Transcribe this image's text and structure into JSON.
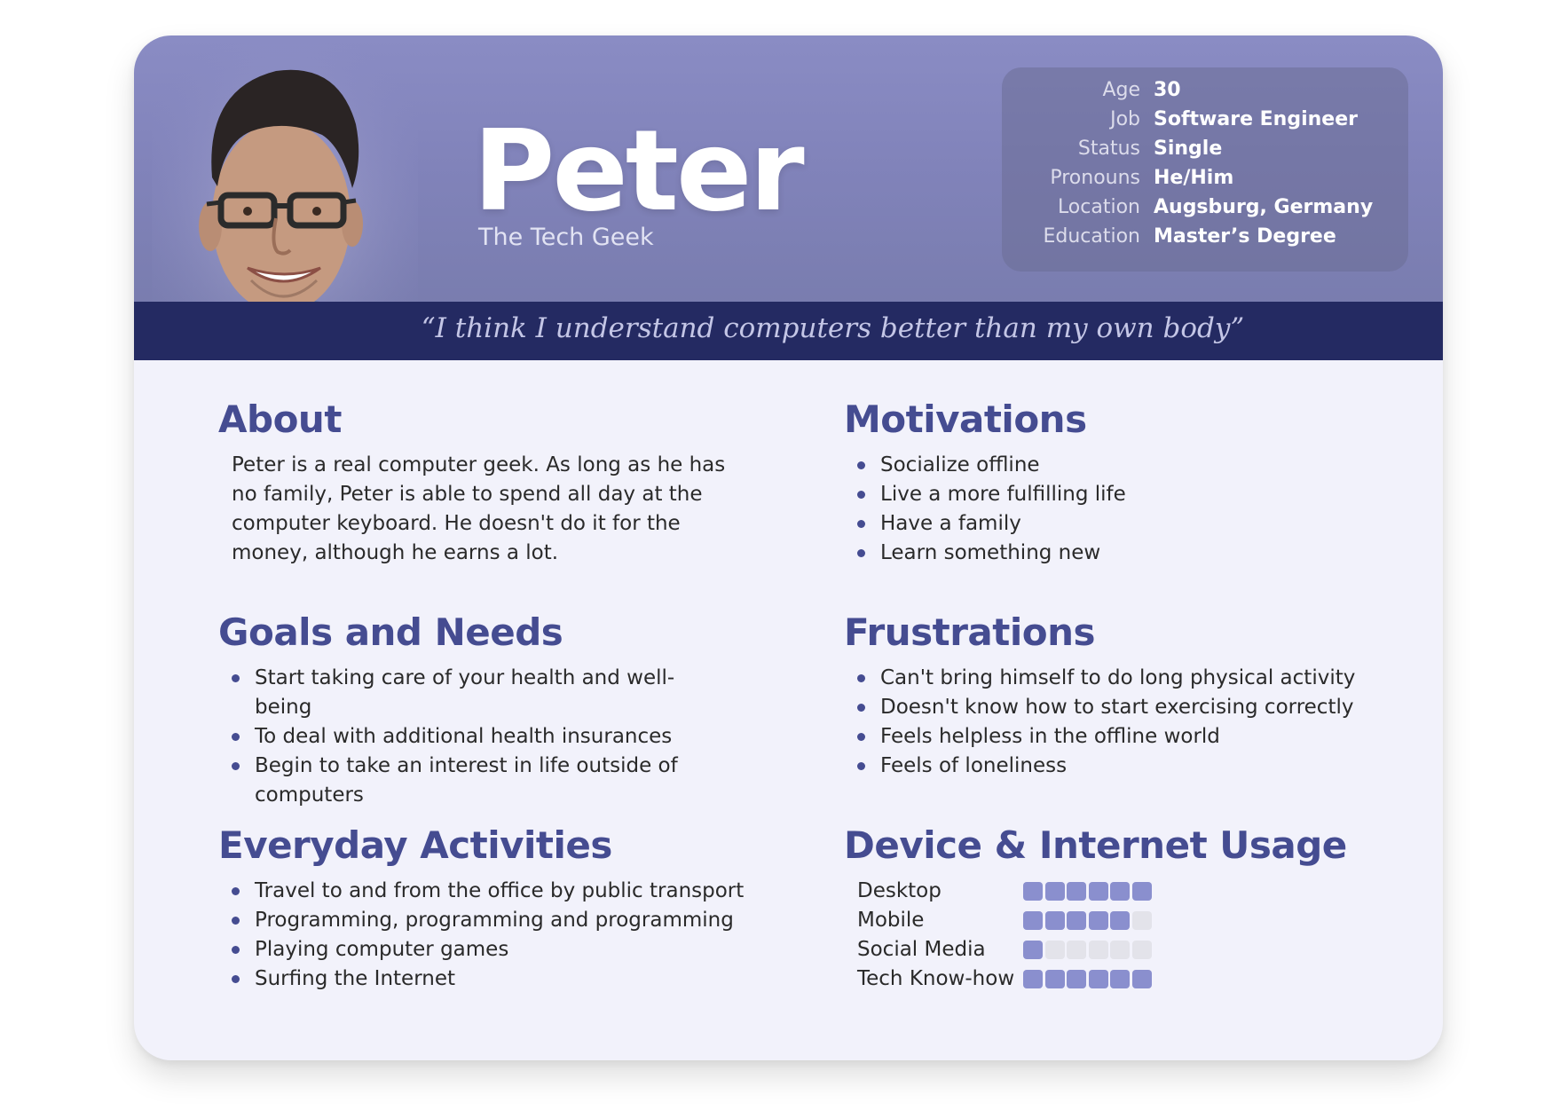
{
  "persona": {
    "name": "Peter",
    "tagline": "The Tech Geek",
    "quote": "“I think I understand computers better than my own body”"
  },
  "info": [
    {
      "label": "Age",
      "value": "30"
    },
    {
      "label": "Job",
      "value": "Software Engineer"
    },
    {
      "label": "Status",
      "value": "Single"
    },
    {
      "label": "Pronouns",
      "value": "He/Him"
    },
    {
      "label": "Location",
      "value": "Augsburg, Germany"
    },
    {
      "label": "Education",
      "value": "Master’s Degree"
    }
  ],
  "about": {
    "heading": "About",
    "text": "Peter is a real computer geek. As long as he has no family, Peter is able to spend all day at the computer keyboard. He doesn't do it for the money, although he earns a lot."
  },
  "goals": {
    "heading": "Goals and Needs",
    "items": [
      "Start taking care of your health and well-being",
      "To deal with additional health insurances",
      "Begin to take an interest in life outside of computers"
    ]
  },
  "activities": {
    "heading": "Everyday Activities",
    "items": [
      "Travel to and from the office by public transport",
      "Programming, programming and programming",
      "Playing computer games",
      "Surfing the Internet"
    ]
  },
  "motivations": {
    "heading": "Motivations",
    "items": [
      "Socialize offline",
      "Live a more fulfilling life",
      "Have a family",
      "Learn something new"
    ]
  },
  "frustrations": {
    "heading": "Frustrations",
    "items": [
      "Can't bring himself to do long physical activity",
      "Doesn't know how to start exercising correctly",
      "Feels helpless in the offline world",
      "Feels of loneliness"
    ]
  },
  "usage": {
    "heading": "Device & Internet Usage",
    "max": 6,
    "rows": [
      {
        "label": "Desktop",
        "level": 6
      },
      {
        "label": "Mobile",
        "level": 5
      },
      {
        "label": "Social Media",
        "level": 1
      },
      {
        "label": "Tech Know-how",
        "level": 6
      }
    ]
  },
  "colors": {
    "accent": "#454c91",
    "quote_bar": "#242a62",
    "header_bg": "#8183ba",
    "bar_on": "#8a8fce",
    "bar_off": "#e3e3ea"
  },
  "icons": {
    "portrait": "avatar-portrait"
  }
}
